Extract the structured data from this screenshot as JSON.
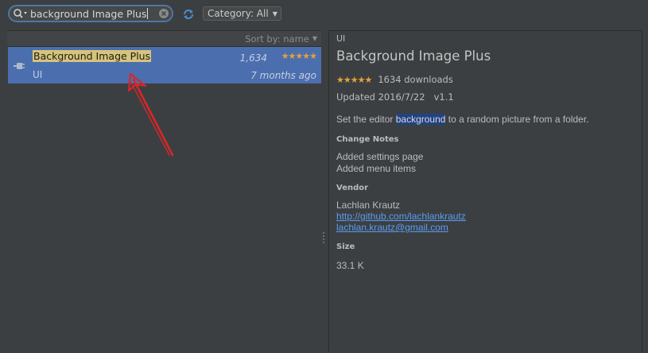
{
  "search": {
    "value": "background Image Plus"
  },
  "filter": {
    "category_label": "Category: All"
  },
  "list": {
    "sort_label": "Sort by: name",
    "items": [
      {
        "name": "Background Image Plus",
        "category": "UI",
        "downloads": "1,634",
        "rating": 5,
        "updated": "7 months ago"
      }
    ]
  },
  "detail": {
    "category": "UI",
    "title": "Background Image Plus",
    "downloads": "1634 downloads",
    "rating": 5,
    "updated": "Updated 2016/7/22",
    "version": "v1.1",
    "description_pre": "Set the editor ",
    "description_highlight": "background",
    "description_post": " to a random picture from a folder.",
    "change_notes_heading": "Change Notes",
    "change_notes": [
      "Added settings page",
      "Added menu items"
    ],
    "vendor_heading": "Vendor",
    "vendor_name": "Lachlan Krautz",
    "vendor_url": "http://github.com/lachlankrautz",
    "vendor_email": "lachlan.krautz@gmail.com",
    "size_heading": "Size",
    "size": "33.1 K"
  },
  "colors": {
    "panel_bg": "#3c3f41",
    "selection": "#4b6eaf",
    "search_match": "#d6c47a",
    "star": "#e5a13a",
    "link": "#589df6",
    "annotation_arrow": "#d8262a"
  },
  "icons": {
    "search": "search-icon",
    "clear": "clear-search-icon",
    "refresh": "refresh-icon",
    "plugin": "plugin-plug-icon",
    "dropdown": "chevron-down-icon"
  }
}
